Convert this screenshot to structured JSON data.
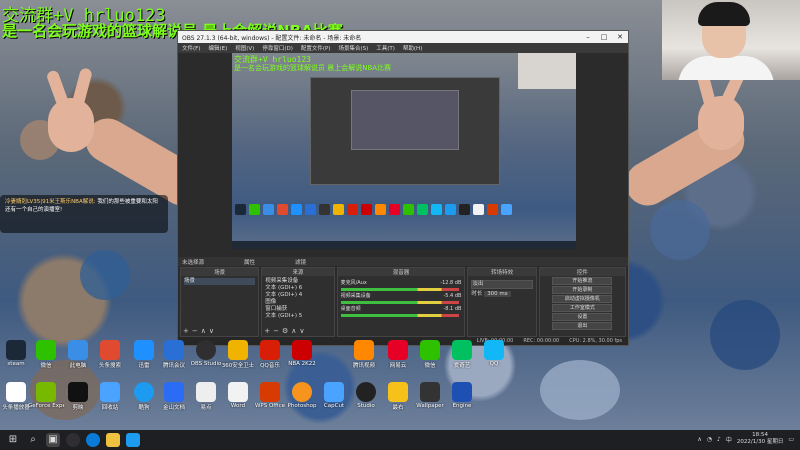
{
  "overlay": {
    "line1": "交流群+V hrluo123",
    "line2": "是一名会玩游戏的篮球解说员 晨上会解说NBA比赛"
  },
  "chat": {
    "user": "冷妻婿剋LV35|91米王斯乐NBA解说:",
    "message": "我们的那些被重要和太阳还有一个自己的演播室!"
  },
  "obs": {
    "title": "OBS 27.1.3 (64-bit, windows) - 配置文件: 未命名 - 场景: 未命名",
    "menu": [
      "文件(F)",
      "编辑(E)",
      "视图(V)",
      "停靠窗口(D)",
      "配置文件(P)",
      "场景集合(S)",
      "工具(T)",
      "帮助(H)"
    ],
    "preview": {
      "line1": "交流群+V hrluo123",
      "line2": "是一名会玩游戏的篮球解说员 晨上会解说NBA比赛"
    },
    "dock_bar": {
      "left": "未选择源",
      "properties": "属性",
      "filters": "滤镜"
    },
    "docks": {
      "scenes": {
        "header": "场景",
        "items": [
          "场景"
        ]
      },
      "sources": {
        "header": "来源",
        "items": [
          "视频采集设备",
          "文本 (GDI+) 6",
          "文本 (GDI+) 4",
          "图像",
          "窗口捕获",
          "文本 (GDI+) 5",
          "文本 (GDI+) 3",
          "图像 2"
        ]
      },
      "mixer": {
        "header": "混音器",
        "rows": [
          {
            "name": "麦克风/Aux",
            "db": "-12.8 dB"
          },
          {
            "name": "视频采集设备",
            "db": "-5.4 dB"
          },
          {
            "name": "桌面音频",
            "db": "-8.1 dB"
          }
        ]
      },
      "transitions": {
        "header": "转场特效",
        "type": "淡出",
        "duration_label": "时长",
        "duration": "300 ms"
      },
      "controls": {
        "header": "控件",
        "buttons": [
          "开始推流",
          "开始录制",
          "启动虚拟摄像机",
          "工作室模式",
          "设置",
          "退出"
        ]
      }
    },
    "status": {
      "live": "LIVE: 00:00:00",
      "rec": "REC: 00:00:00",
      "cpu": "CPU: 2.8%, 30.00 fps"
    }
  },
  "desktop_icons": {
    "row1": [
      "steam",
      "微信",
      "此电脑",
      "头条搜索",
      "迅雷",
      "腾讯会议",
      "OBS Studio",
      "360安全卫士",
      "QQ音乐",
      "NBA 2K22",
      "腾讯视频",
      "网易云",
      "微信",
      "爱奇艺",
      "QQ"
    ],
    "row2": [
      "头条播放器",
      "GeForce Experience",
      "剪映",
      "回收站",
      "酷狗",
      "金山文档",
      "易点",
      "Word",
      "WPS Office",
      "Photoshop",
      "CapCut",
      "Studio",
      "最右",
      "Wallpaper",
      "Engine"
    ]
  },
  "taskbar": {
    "time": "18:54",
    "date": "2022/1/30 星期日",
    "lang": "中"
  },
  "icon_names": [
    "windows-start-icon",
    "search-icon",
    "obs-icon",
    "edge-icon",
    "folder-icon",
    "chat-icon"
  ]
}
